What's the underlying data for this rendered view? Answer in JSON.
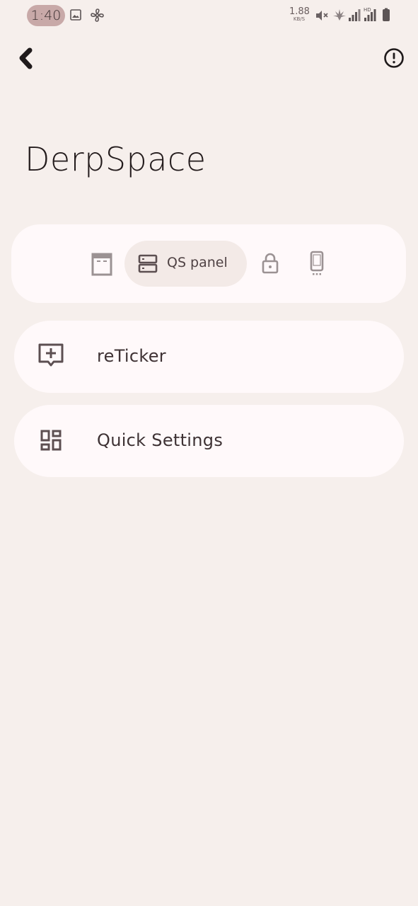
{
  "status_bar": {
    "time": "1:40",
    "net_speed_value": "1.88",
    "net_speed_unit": "KB/S",
    "icons": [
      "gallery-icon",
      "fan-icon",
      "mute-icon",
      "leaf-icon",
      "signal-icon",
      "signal-hd-icon",
      "battery-icon"
    ]
  },
  "header": {
    "back_icon": "back-chevron-icon",
    "info_icon": "info-circle-icon"
  },
  "page": {
    "title": "DerpSpace"
  },
  "tabs": {
    "items": [
      {
        "icon": "statusbar-icon",
        "label": ""
      },
      {
        "icon": "qs-panel-icon",
        "label": "QS panel",
        "selected": true
      },
      {
        "icon": "lock-icon",
        "label": ""
      },
      {
        "icon": "phone-icon",
        "label": ""
      }
    ]
  },
  "list": {
    "items": [
      {
        "icon": "message-add-icon",
        "label": "reTicker"
      },
      {
        "icon": "dashboard-icon",
        "label": "Quick Settings"
      }
    ]
  },
  "colors": {
    "background": "#F6EFEC",
    "card": "#FFF9FA",
    "time_pill": "#C8A9A8",
    "selected_tab": "#F3EAE7",
    "icon": "#5C4F51"
  }
}
